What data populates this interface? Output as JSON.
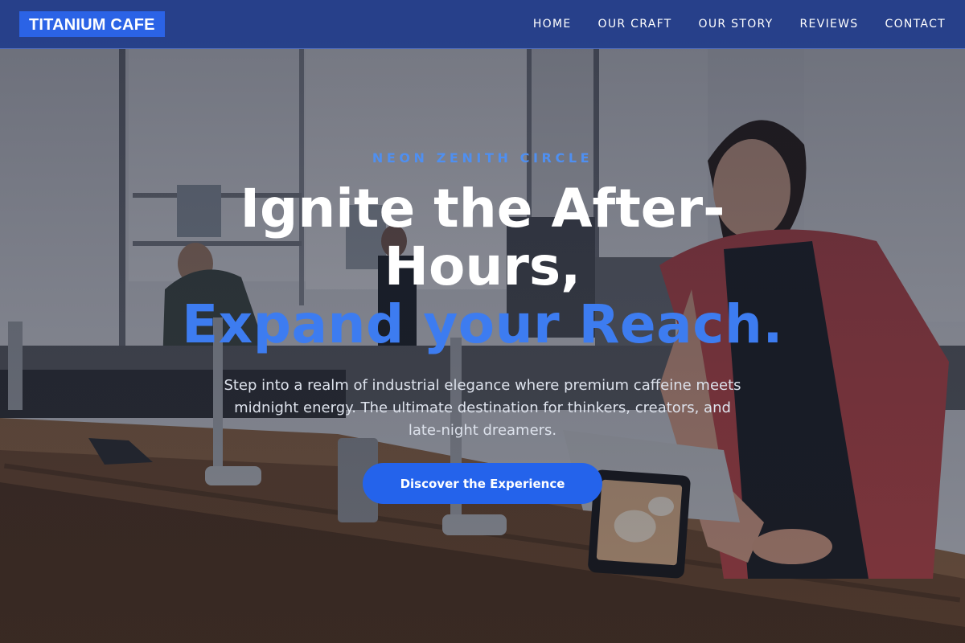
{
  "brand": {
    "logo_text": "TITANIUM CAFE"
  },
  "nav": {
    "items": [
      {
        "label": "HOME"
      },
      {
        "label": "OUR CRAFT"
      },
      {
        "label": "OUR STORY"
      },
      {
        "label": "REVIEWS"
      },
      {
        "label": "CONTACT"
      }
    ]
  },
  "hero": {
    "eyebrow": "NEON ZENITH CIRCLE",
    "headline_line1": "Ignite the After-",
    "headline_line2": "Hours,",
    "headline_line3": "Expand your Reach.",
    "subtext": "Step into a realm of industrial elegance where premium caffeine meets midnight energy. The ultimate destination for thinkers, creators, and late-night dreamers.",
    "cta_label": "Discover the Experience"
  },
  "colors": {
    "navbar": "#223d8c",
    "logo_bg": "#2b63e6",
    "accent_text": "#3d7cf0",
    "cta_bg": "#2463eb"
  }
}
